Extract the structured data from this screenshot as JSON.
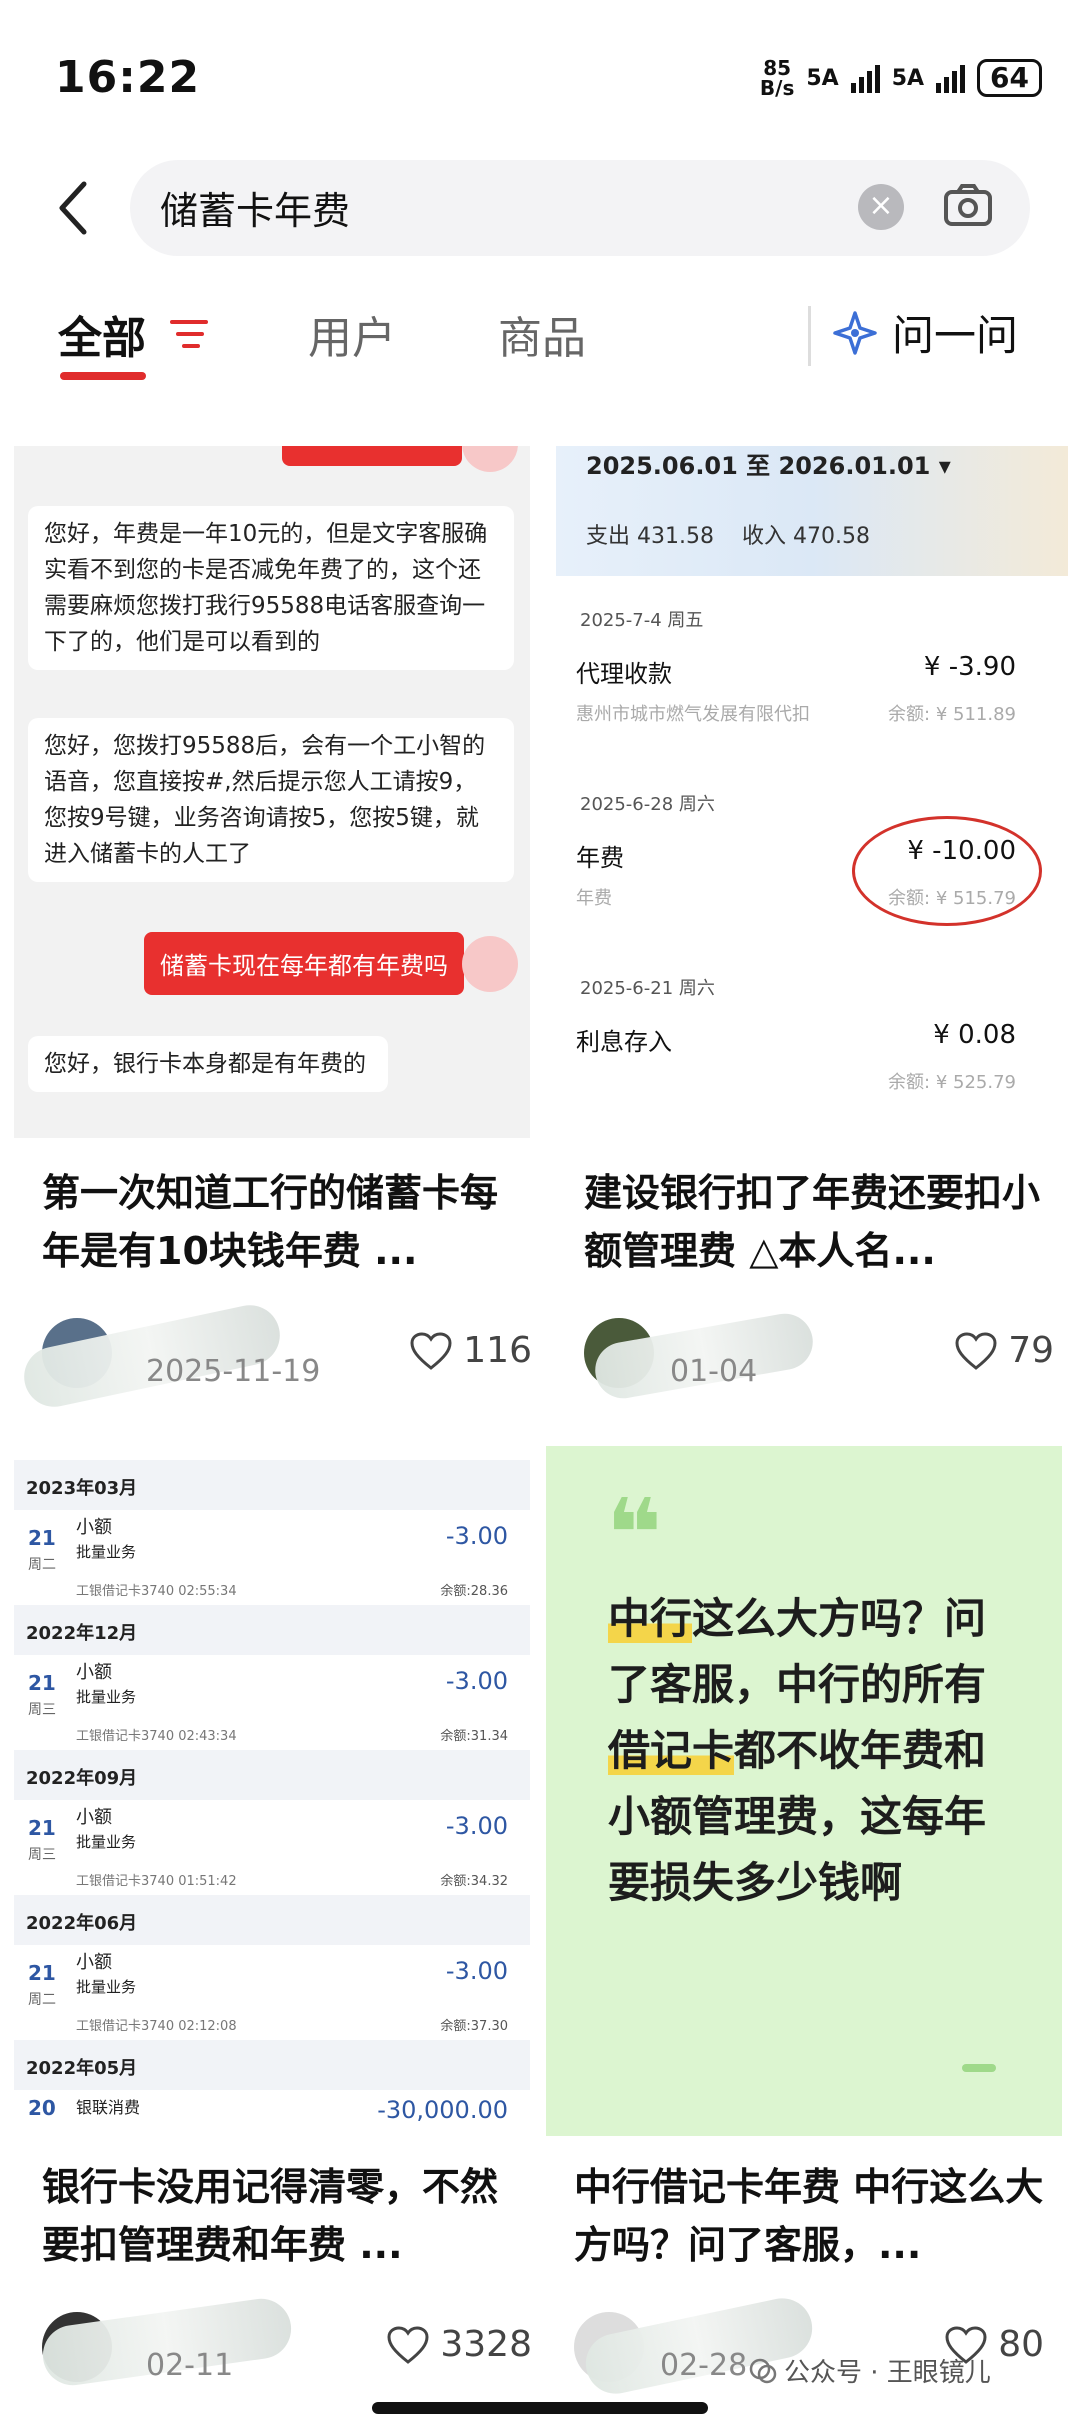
{
  "status": {
    "time": "16:22",
    "net_top": "85",
    "net_bottom": "B/s",
    "sig1": "5A",
    "sig2": "5A",
    "battery": "64"
  },
  "search": {
    "query": "储蓄卡年费",
    "clear_symbol": "×"
  },
  "tabs": [
    {
      "label": "全部"
    },
    {
      "label": "用户"
    },
    {
      "label": "商品"
    }
  ],
  "ask": {
    "label": "问一问"
  },
  "cards": [
    {
      "title": "第一次知道工行的储蓄卡每年是有10块钱年费 ...",
      "author": "",
      "date": "2025-11-19",
      "likes": "116",
      "chat": {
        "msg1": "您好，年费是一年10元的，但是文字客服确实看不到您的卡是否减免年费了的，这个还需要麻烦您拨打我行95588电话客服查询一下了的，他们是可以看到的",
        "msg2": "您好，您拨打95588后，会有一个工小智的语音，您直接按#,然后提示您人工请按9，您按9号键，业务咨询请按5，您按5键，就进入储蓄卡的人工了",
        "user_msg": "储蓄卡现在每年都有年费吗",
        "msg3": "您好，银行卡本身都是有年费的"
      }
    },
    {
      "title": "建设银行扣了年费还要扣小额管理费 △本人名...",
      "author": "",
      "date": "01-04",
      "likes": "79",
      "statement": {
        "range": "2025.06.01 至 2026.01.01",
        "range_caret": "▾",
        "out_label": "支出",
        "out": "431.58",
        "in_label": "收入",
        "in": "470.58",
        "entries": [
          {
            "date": "2025-7-4 周五",
            "name": "代理收款",
            "amount": "¥ -3.90",
            "sub": "惠州市城市燃气发展有限代扣",
            "bal": "余额: ¥ 511.89"
          },
          {
            "date": "2025-6-28 周六",
            "name": "年费",
            "amount": "¥ -10.00",
            "sub": "年费",
            "bal": "余额: ¥ 515.79"
          },
          {
            "date": "2025-6-21 周六",
            "name": "利息存入",
            "amount": "¥ 0.08",
            "sub": "",
            "bal": "余额: ¥ 525.79"
          }
        ]
      }
    },
    {
      "title": "银行卡没用记得清零，不然要扣管理费和年费 ...",
      "author": "",
      "date": "02-11",
      "likes": "3328",
      "list": {
        "months": [
          {
            "month": "2023年03月",
            "day": "21",
            "wk": "周二",
            "tx1": "小额",
            "tx2": "批量业务",
            "amount": "-3.00",
            "acc": "工银借记卡3740 02:55:34",
            "bal": "余额:28.36"
          },
          {
            "month": "2022年12月",
            "day": "21",
            "wk": "周三",
            "tx1": "小额",
            "tx2": "批量业务",
            "amount": "-3.00",
            "acc": "工银借记卡3740 02:43:34",
            "bal": "余额:31.34"
          },
          {
            "month": "2022年09月",
            "day": "21",
            "wk": "周三",
            "tx1": "小额",
            "tx2": "批量业务",
            "amount": "-3.00",
            "acc": "工银借记卡3740 01:51:42",
            "bal": "余额:34.32"
          },
          {
            "month": "2022年06月",
            "day": "21",
            "wk": "周二",
            "tx1": "小额",
            "tx2": "批量业务",
            "amount": "-3.00",
            "acc": "工银借记卡3740 02:12:08",
            "bal": "余额:37.30"
          }
        ],
        "last_month": "2022年05月",
        "last_day": "20",
        "last_tx": "银联消费",
        "last_amount": "-30,000.00"
      }
    },
    {
      "title": "中行借记卡年费 中行这么大方吗？问了客服，...",
      "author": "",
      "date": "02-28",
      "likes": "80",
      "quote": {
        "mark": "❝",
        "part1": "中行",
        "part2": "这么大方吗？问了客服，中行的所有",
        "part3": "借记卡",
        "part4": "都不收年费和小额管理费，这每年要损失多少钱啊"
      }
    }
  ],
  "watermark": "公众号 · 王眼镜儿"
}
